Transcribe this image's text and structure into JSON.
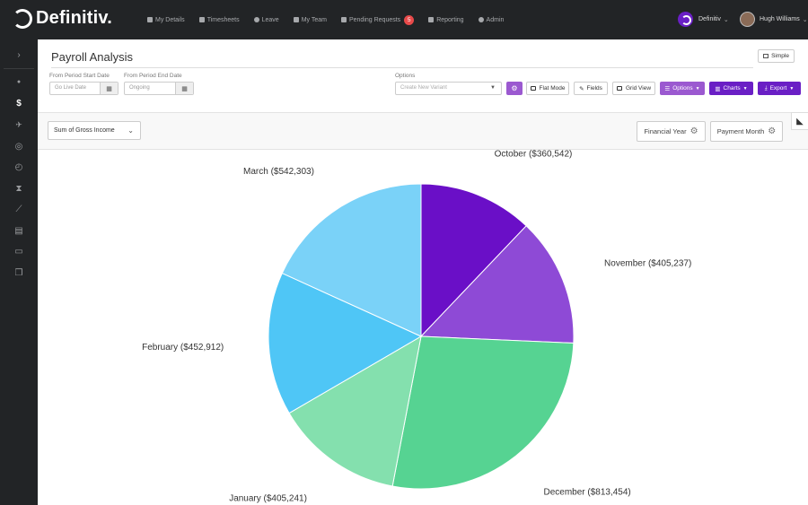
{
  "brand": {
    "name": "Definitiv."
  },
  "nav": [
    {
      "label": "My Details",
      "icon": "user-icon"
    },
    {
      "label": "Timesheets",
      "icon": "calendar-icon"
    },
    {
      "label": "Leave",
      "icon": "clock-icon"
    },
    {
      "label": "My Team",
      "icon": "team-icon"
    },
    {
      "label": "Pending Requests",
      "icon": "check-icon",
      "badge": "5"
    },
    {
      "label": "Reporting",
      "icon": "bar-chart-icon"
    },
    {
      "label": "Admin",
      "icon": "gear-icon"
    }
  ],
  "company": {
    "name": "Definitiv"
  },
  "user": {
    "name": "Hugh Williams"
  },
  "sidebar": {
    "items": [
      {
        "icon": "chevron-right-icon",
        "glyph": "›"
      },
      {
        "icon": "user-icon",
        "glyph": "●"
      },
      {
        "icon": "dollar-icon",
        "glyph": "$",
        "active": true
      },
      {
        "icon": "plane-icon",
        "glyph": "✈"
      },
      {
        "icon": "support-icon",
        "glyph": "◎"
      },
      {
        "icon": "clock-icon",
        "glyph": "◴"
      },
      {
        "icon": "hourglass-icon",
        "glyph": "⧗"
      },
      {
        "icon": "line-chart-icon",
        "glyph": "⟋"
      },
      {
        "icon": "document-icon",
        "glyph": "▤"
      },
      {
        "icon": "folder-icon",
        "glyph": "▭"
      },
      {
        "icon": "cubes-icon",
        "glyph": "❒"
      }
    ]
  },
  "page": {
    "title": "Payroll Analysis",
    "simple_label": "Simple"
  },
  "filters": {
    "start_label": "From Period Start Date",
    "start_placeholder": "Go Live Date",
    "end_label": "From Period End Date",
    "end_placeholder": "Ongoing",
    "options_label": "Options",
    "variant_placeholder": "Create New Variant"
  },
  "toolbar": {
    "flat_mode": "Flat Mode",
    "fields": "Fields",
    "grid_view": "Grid View",
    "options": "Options",
    "charts": "Charts",
    "export": "Export"
  },
  "pivot": {
    "measure": "Sum of Gross Income",
    "dimension_1": "Financial Year",
    "dimension_2": "Payment Month"
  },
  "colors": {
    "brand_purple": "#6a1fc5",
    "light_purple": "#9b59d0"
  },
  "chart_data": {
    "type": "pie",
    "slices": [
      {
        "label": "October ($360,542)",
        "value": 360542,
        "color": "#6a0fc7"
      },
      {
        "label": "November ($405,237)",
        "value": 405237,
        "color": "#8e4ad6"
      },
      {
        "label": "December ($813,454)",
        "value": 813454,
        "color": "#56d392"
      },
      {
        "label": "January ($405,241)",
        "value": 405241,
        "color": "#84e0ae"
      },
      {
        "label": "February ($452,912)",
        "value": 452912,
        "color": "#4fc6f6"
      },
      {
        "label": "March ($542,303)",
        "value": 542303,
        "color": "#7ad2f8"
      }
    ],
    "start": "top",
    "direction": "clockwise"
  }
}
